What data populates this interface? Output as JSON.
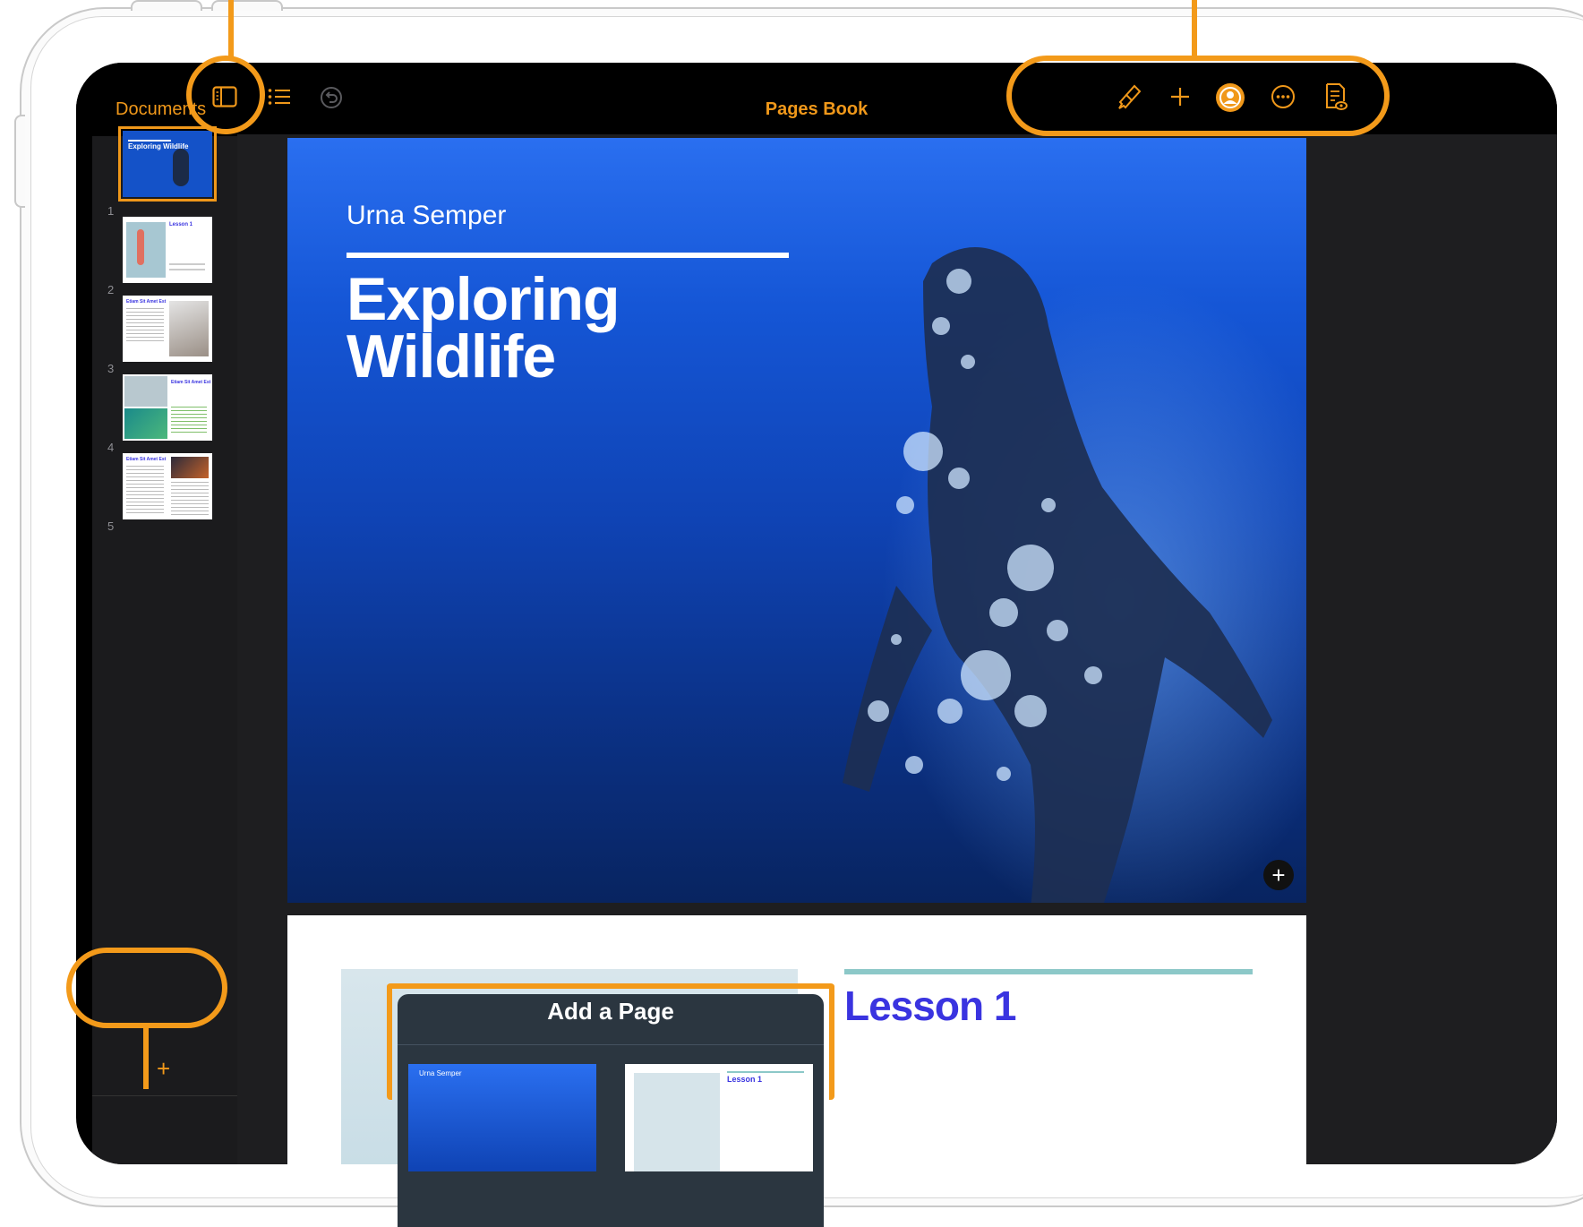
{
  "toolbar": {
    "documents_label": "Documents",
    "title": "Pages Book",
    "icons": [
      "sidebar-icon",
      "list-icon",
      "undo-icon",
      "paintbrush-icon",
      "plus-icon",
      "collaborate-icon",
      "more-icon",
      "reading-view-icon"
    ]
  },
  "sidebar": {
    "pages": [
      {
        "number": "1",
        "heading": "Exploring Wildlife",
        "selected": true
      },
      {
        "number": "2",
        "heading": "Lesson 1"
      },
      {
        "number": "3",
        "heading": "Etiam Sit Amet Est"
      },
      {
        "number": "4",
        "heading": "Etiam Sit Amet Est"
      },
      {
        "number": "5",
        "heading": "Etiam Sit Amet Est"
      }
    ],
    "add_label": "+"
  },
  "page1": {
    "author": "Urna Semper",
    "title_line1": "Exploring",
    "title_line2": "Wildlife",
    "add_button": "+"
  },
  "page2": {
    "heading": "Lesson 1"
  },
  "popover": {
    "title": "Add a Page",
    "thumb1_label": "Urna Semper",
    "thumb2_label": "Lesson 1"
  },
  "colors": {
    "accent": "#f0981a",
    "callout": "#f39a1a",
    "lesson_text": "#3a34e0",
    "page_blue": "#1556d6"
  }
}
